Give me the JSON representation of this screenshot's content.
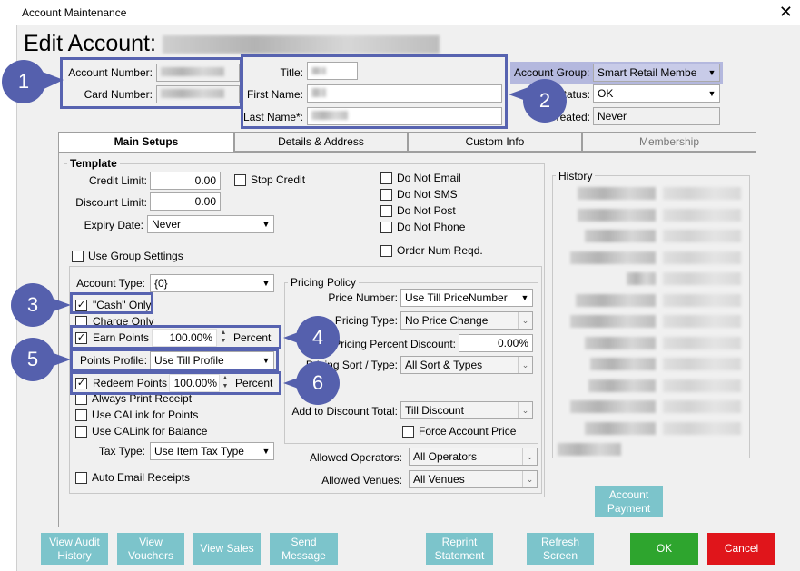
{
  "window": {
    "title": "Account Maintenance",
    "close_glyph": "✕"
  },
  "header": {
    "title": "Edit Account:"
  },
  "account": {
    "number_label": "Account Number:",
    "card_label": "Card Number:",
    "title_label": "Title:",
    "first_name_label": "First Name:",
    "last_name_label": "Last Name*:",
    "group_label": "Account Group:",
    "group_value": "Smart Retail Membe",
    "status_label": "Status:",
    "status_value": "OK",
    "created_label": "Created:",
    "created_value": "Never"
  },
  "tabs": [
    {
      "label": "Main Setups"
    },
    {
      "label": "Details & Address"
    },
    {
      "label": "Custom Info"
    },
    {
      "label": "Membership"
    }
  ],
  "template": {
    "title": "Template",
    "credit_limit_label": "Credit Limit:",
    "credit_limit_value": "0.00",
    "stop_credit_label": "Stop Credit",
    "discount_limit_label": "Discount Limit:",
    "discount_limit_value": "0.00",
    "expiry_label": "Expiry Date:",
    "expiry_value": "Never",
    "do_not_email": "Do Not Email",
    "do_not_sms": "Do Not SMS",
    "do_not_post": "Do Not Post",
    "do_not_phone": "Do Not Phone",
    "order_num_reqd": "Order Num Reqd.",
    "use_group_settings": "Use Group Settings",
    "account_type_label": "Account Type:",
    "account_type_value": "{0}",
    "cash_only": "\"Cash\" Only",
    "charge_only": "Charge Only",
    "earn_points": "Earn Points",
    "earn_points_value": "100.00%",
    "percent": "Percent",
    "points_profile_label": "Points Profile:",
    "points_profile_value": "Use Till Profile",
    "redeem_points": "Redeem Points",
    "redeem_points_value": "100.00%",
    "always_print_receipt": "Always Print Receipt",
    "use_calink_points": "Use CALink for Points",
    "use_calink_balance": "Use CALink for Balance",
    "tax_type_label": "Tax Type:",
    "tax_type_value": "Use Item Tax Type",
    "auto_email_receipts": "Auto Email Receipts"
  },
  "pricing": {
    "title": "Pricing Policy",
    "price_number_label": "Price Number:",
    "price_number_value": "Use Till PriceNumber",
    "pricing_type_label": "Pricing Type:",
    "pricing_type_value": "No Price Change",
    "pricing_percent_label": "Pricing Percent Discount:",
    "pricing_percent_value": "0.00%",
    "pricing_sort_label": "Pricing Sort / Type:",
    "pricing_sort_value": "All Sort & Types",
    "add_discount_label": "Add to Discount Total:",
    "add_discount_value": "Till Discount",
    "force_account_price": "Force Account Price"
  },
  "operators": {
    "allowed_operators_label": "Allowed Operators:",
    "allowed_operators_value": "All Operators",
    "allowed_venues_label": "Allowed Venues:",
    "allowed_venues_value": "All Venues"
  },
  "history": {
    "title": "History"
  },
  "buttons": {
    "account_payment": "Account Payment",
    "view_audit_history": "View Audit History",
    "view_vouchers": "View Vouchers",
    "view_sales": "View Sales",
    "send_message": "Send Message",
    "reprint_statement": "Reprint Statement",
    "refresh_screen": "Refresh Screen",
    "ok": "OK",
    "cancel": "Cancel"
  },
  "callouts": [
    "1",
    "2",
    "3",
    "4",
    "5",
    "6"
  ],
  "colors": {
    "accent": "#5763b0",
    "button": "#7cc4cb",
    "ok": "#2ea52e",
    "cancel": "#e0151b"
  }
}
